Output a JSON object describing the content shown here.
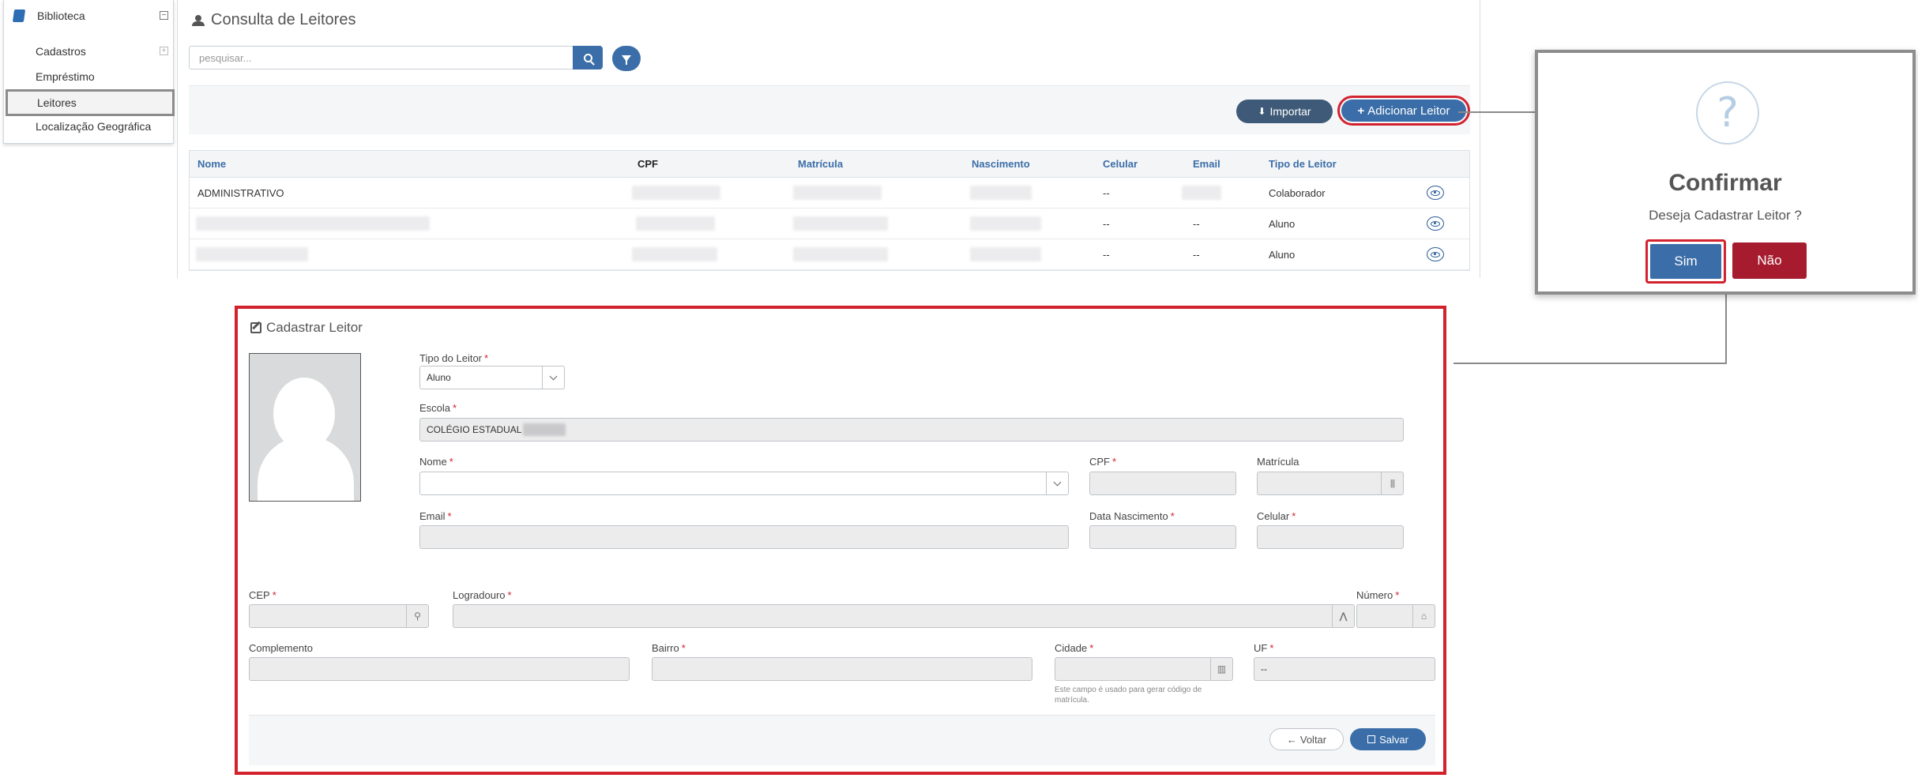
{
  "sidebar": {
    "section_title": "Biblioteca",
    "items": [
      {
        "label": "Cadastros"
      },
      {
        "label": "Empréstimo"
      },
      {
        "label": "Leitores"
      },
      {
        "label": "Localização Geográfica"
      }
    ]
  },
  "consulta": {
    "title": "Consulta de Leitores",
    "search_placeholder": "pesquisar...",
    "import_label": "Importar",
    "add_label": "Adicionar Leitor",
    "columns": [
      "Nome",
      "CPF",
      "Matrícula",
      "Nascimento",
      "Celular",
      "Email",
      "Tipo de Leitor"
    ],
    "rows": [
      {
        "nome": "ADMINISTRATIVO",
        "celular": "--",
        "email": "",
        "tipo": "Colaborador"
      },
      {
        "nome": "",
        "celular": "--",
        "email": "--",
        "tipo": "Aluno"
      },
      {
        "nome": "",
        "celular": "--",
        "email": "--",
        "tipo": "Aluno"
      }
    ]
  },
  "confirm": {
    "icon": "?",
    "title": "Confirmar",
    "message": "Deseja Cadastrar Leitor ?",
    "yes_label": "Sim",
    "no_label": "Não"
  },
  "form": {
    "title": "Cadastrar Leitor",
    "tipo_label": "Tipo do Leitor",
    "tipo_value": "Aluno",
    "escola_label": "Escola",
    "escola_value": "COLÉGIO ESTADUAL",
    "nome_label": "Nome",
    "cpf_label": "CPF",
    "matricula_label": "Matrícula",
    "email_label": "Email",
    "nascimento_label": "Data Nascimento",
    "celular_label": "Celular",
    "cep_label": "CEP",
    "logradouro_label": "Logradouro",
    "numero_label": "Número",
    "complemento_label": "Complemento",
    "bairro_label": "Bairro",
    "cidade_label": "Cidade",
    "uf_label": "UF",
    "uf_value": "--",
    "cidade_hint": "Este campo é usado para gerar código de matrícula.",
    "back_label": "Voltar",
    "save_label": "Salvar"
  },
  "colors": {
    "primary": "#3b6ea8",
    "danger": "#a61c2e",
    "highlight": "#d2222e"
  }
}
